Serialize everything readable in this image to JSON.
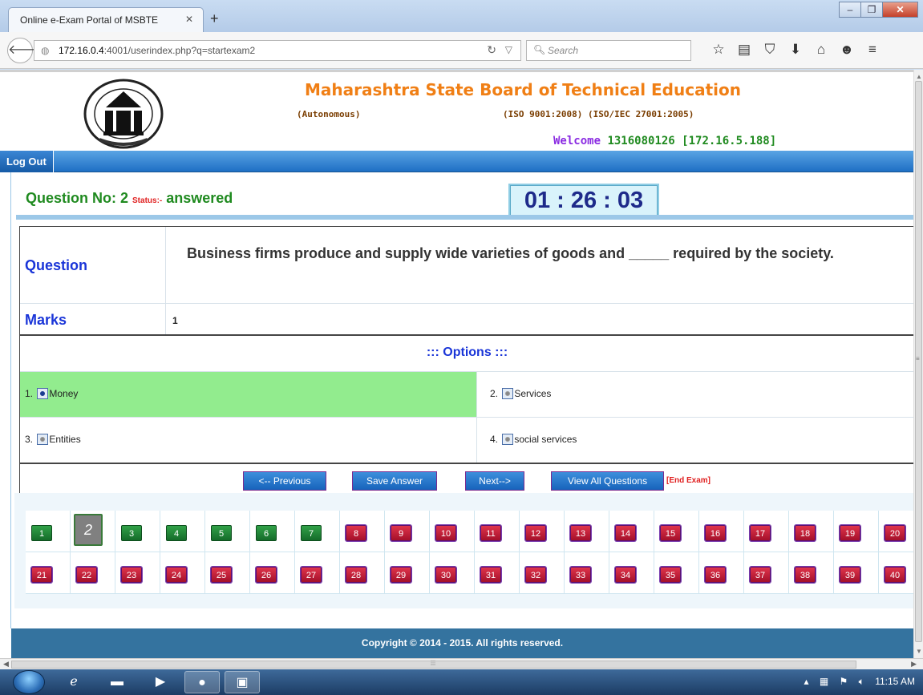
{
  "browser": {
    "tab_title": "Online e-Exam Portal of MSBTE",
    "url_host": "172.16.0.4",
    "url_rest": ":4001/userindex.php?q=startexam2",
    "search_placeholder": "Search"
  },
  "header": {
    "org_name": "Maharashtra State Board of Technical Education",
    "autonomous": "(Autonomous)",
    "iso": "(ISO 9001:2008) (ISO/IEC 27001:2005)",
    "welcome_prefix": "Welcome ",
    "welcome_user": "1316080126 [172.16.5.188]"
  },
  "menu": {
    "logout": "Log Out"
  },
  "question": {
    "number_label": "Question No: 2 ",
    "status_label": "Status:-",
    "status_value": " answered",
    "timer": "01 : 26 : 03",
    "question_label": "Question",
    "text": "Business firms produce and supply wide varieties of goods and _____ required by the society.",
    "marks_label": "Marks",
    "marks_value": "1",
    "options_heading": "::: Options :::",
    "options": [
      {
        "num": "1.",
        "label": "Money",
        "selected": true
      },
      {
        "num": "2.",
        "label": "Services",
        "selected": false
      },
      {
        "num": "3.",
        "label": "Entities",
        "selected": false
      },
      {
        "num": "4.",
        "label": "social services",
        "selected": false
      }
    ]
  },
  "buttons": {
    "previous": "<-- Previous",
    "save": "Save Answer",
    "next": "Next-->",
    "view_all": "View All Questions",
    "end_exam": "[End Exam]"
  },
  "question_grid": {
    "current": 2,
    "answered": [
      1,
      3,
      4,
      5,
      6,
      7
    ],
    "numbers": [
      1,
      2,
      3,
      4,
      5,
      6,
      7,
      8,
      9,
      10,
      11,
      12,
      13,
      14,
      15,
      16,
      17,
      18,
      19,
      20,
      21,
      22,
      23,
      24,
      25,
      26,
      27,
      28,
      29,
      30,
      31,
      32,
      33,
      34,
      35,
      36,
      37,
      38,
      39,
      40
    ]
  },
  "footer": {
    "copyright": "Copyright © 2014 - 2015. All rights reserved."
  },
  "taskbar": {
    "clock": "11:15 AM"
  }
}
